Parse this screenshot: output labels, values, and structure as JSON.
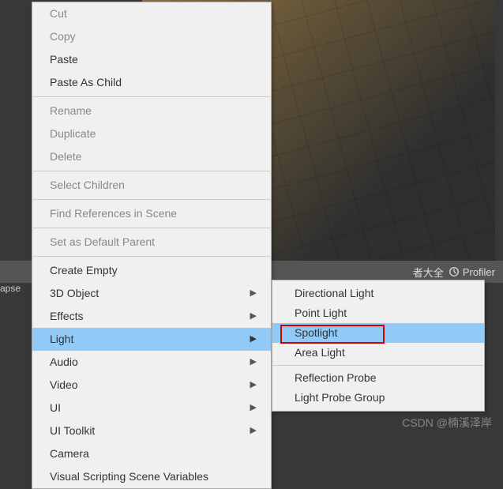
{
  "toolbar": {
    "label_cn": "者大全",
    "profiler": "Profiler",
    "left_fragment": "apse"
  },
  "main_menu": {
    "group1": [
      {
        "label": "Cut",
        "enabled": false
      },
      {
        "label": "Copy",
        "enabled": false
      },
      {
        "label": "Paste",
        "enabled": true
      },
      {
        "label": "Paste As Child",
        "enabled": true
      }
    ],
    "group2": [
      {
        "label": "Rename",
        "enabled": false
      },
      {
        "label": "Duplicate",
        "enabled": false
      },
      {
        "label": "Delete",
        "enabled": false
      }
    ],
    "group3": [
      {
        "label": "Select Children",
        "enabled": false
      }
    ],
    "group4": [
      {
        "label": "Find References in Scene",
        "enabled": false
      }
    ],
    "group5": [
      {
        "label": "Set as Default Parent",
        "enabled": false
      }
    ],
    "group6": [
      {
        "label": "Create Empty",
        "submenu": false
      },
      {
        "label": "3D Object",
        "submenu": true
      },
      {
        "label": "Effects",
        "submenu": true
      },
      {
        "label": "Light",
        "submenu": true,
        "highlight": true
      },
      {
        "label": "Audio",
        "submenu": true
      },
      {
        "label": "Video",
        "submenu": true
      },
      {
        "label": "UI",
        "submenu": true
      },
      {
        "label": "UI Toolkit",
        "submenu": true
      },
      {
        "label": "Camera",
        "submenu": false
      },
      {
        "label": "Visual Scripting Scene Variables",
        "submenu": false
      }
    ]
  },
  "sub_menu": {
    "group1": [
      {
        "label": "Directional Light"
      },
      {
        "label": "Point Light"
      },
      {
        "label": "Spotlight",
        "highlight": true
      },
      {
        "label": "Area Light"
      }
    ],
    "group2": [
      {
        "label": "Reflection Probe"
      },
      {
        "label": "Light Probe Group"
      }
    ]
  },
  "watermark": "CSDN @楠溪泽岸"
}
